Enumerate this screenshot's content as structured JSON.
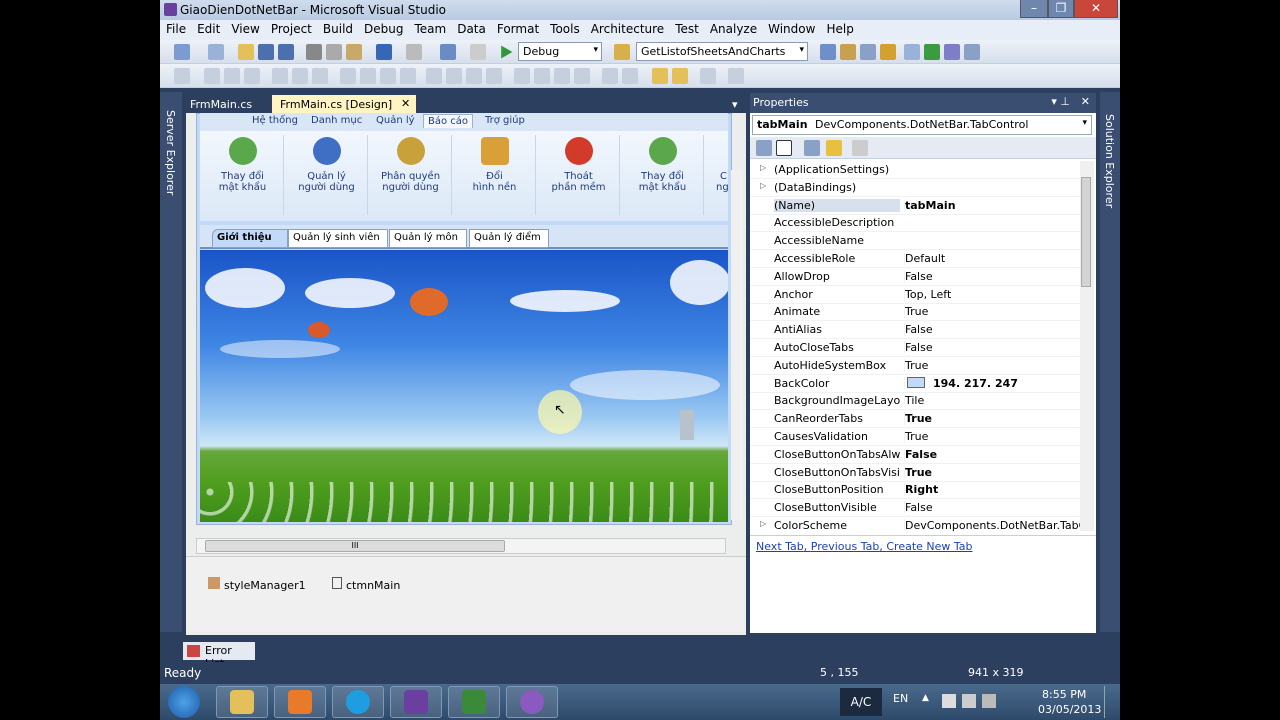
{
  "window": {
    "title": "GiaoDienDotNetBar - Microsoft Visual Studio"
  },
  "menu": [
    "File",
    "Edit",
    "View",
    "Project",
    "Build",
    "Debug",
    "Team",
    "Data",
    "Format",
    "Tools",
    "Architecture",
    "Test",
    "Analyze",
    "Window",
    "Help"
  ],
  "toolbar": {
    "config": "Debug",
    "find": "GetListofSheetsAndCharts"
  },
  "sidebar_left": {
    "label": "Server Explorer"
  },
  "sidebar_right": {
    "label": "Solution Explorer"
  },
  "doc_tabs": [
    {
      "label": "FrmMain.cs",
      "active": false
    },
    {
      "label": "FrmMain.cs [Design]",
      "active": true
    }
  ],
  "ribbon": {
    "tabs": [
      "Hệ thống",
      "Danh mục",
      "Quản lý",
      "Báo cáo",
      "Trợ giúp"
    ],
    "selected_tab": "Báo cáo",
    "buttons": [
      {
        "label1": "Thay đổi",
        "label2": "mật khẩu",
        "color": "#5aa84b"
      },
      {
        "label1": "Quản lý",
        "label2": "người dùng",
        "color": "#3f6fc4"
      },
      {
        "label1": "Phân quyền",
        "label2": "người dùng",
        "color": "#c9a13a"
      },
      {
        "label1": "Đổi",
        "label2": "hình nền",
        "color": "#d9a03a"
      },
      {
        "label1": "Thoát",
        "label2": "phần mềm",
        "color": "#d23a2a"
      },
      {
        "label1": "Thay đổi",
        "label2": "mật khẩu",
        "color": "#5aa84b"
      }
    ],
    "partial_label": "C",
    "partial_label2": "ng"
  },
  "content_tabs": [
    "Giới thiệu",
    "Quản lý sinh viên",
    "Quản lý môn",
    "Quản lý điểm"
  ],
  "content_selected": "Giới thiệu",
  "hscroll_grip": "III",
  "components": [
    "styleManager1",
    "ctmnMain"
  ],
  "error_list": "Error List",
  "properties": {
    "title": "Properties",
    "object": "tabMain",
    "object_type": "DevComponents.DotNetBar.TabControl",
    "rows": [
      {
        "name": "(ApplicationSettings)",
        "value": "",
        "expand": true
      },
      {
        "name": "(DataBindings)",
        "value": "",
        "expand": true
      },
      {
        "name": "(Name)",
        "value": "tabMain",
        "bold": true,
        "selected": true
      },
      {
        "name": "AccessibleDescription",
        "value": ""
      },
      {
        "name": "AccessibleName",
        "value": ""
      },
      {
        "name": "AccessibleRole",
        "value": "Default"
      },
      {
        "name": "AllowDrop",
        "value": "False"
      },
      {
        "name": "Anchor",
        "value": "Top, Left"
      },
      {
        "name": "Animate",
        "value": "True"
      },
      {
        "name": "AntiAlias",
        "value": "False"
      },
      {
        "name": "AutoCloseTabs",
        "value": "False"
      },
      {
        "name": "AutoHideSystemBox",
        "value": "True"
      },
      {
        "name": "BackColor",
        "value": "194. 217. 247",
        "bold": true,
        "swatch": "#c2d9f7"
      },
      {
        "name": "BackgroundImageLayout",
        "value": "Tile"
      },
      {
        "name": "CanReorderTabs",
        "value": "True",
        "bold": true
      },
      {
        "name": "CausesValidation",
        "value": "True"
      },
      {
        "name": "CloseButtonOnTabsAlwa",
        "value": "False",
        "bold": true
      },
      {
        "name": "CloseButtonOnTabsVisibl",
        "value": "True",
        "bold": true
      },
      {
        "name": "CloseButtonPosition",
        "value": "Right",
        "bold": true
      },
      {
        "name": "CloseButtonVisible",
        "value": "False"
      },
      {
        "name": "ColorScheme",
        "value": "DevComponents.DotNetBar.TabCo",
        "expand": true
      }
    ],
    "verbs": [
      "Next Tab",
      "Previous Tab",
      "Create New Tab"
    ]
  },
  "status": {
    "text": "Ready",
    "position": "5 , 155",
    "size": "941 x 319"
  },
  "taskbar": {
    "kb": "A/C",
    "lang": "EN",
    "time": "8:55 PM",
    "date": "03/05/2013"
  },
  "colors": {
    "accent": "#3a4e72",
    "doc_tab_active": "#fff4c2",
    "form_back": "#c2d9f7"
  }
}
